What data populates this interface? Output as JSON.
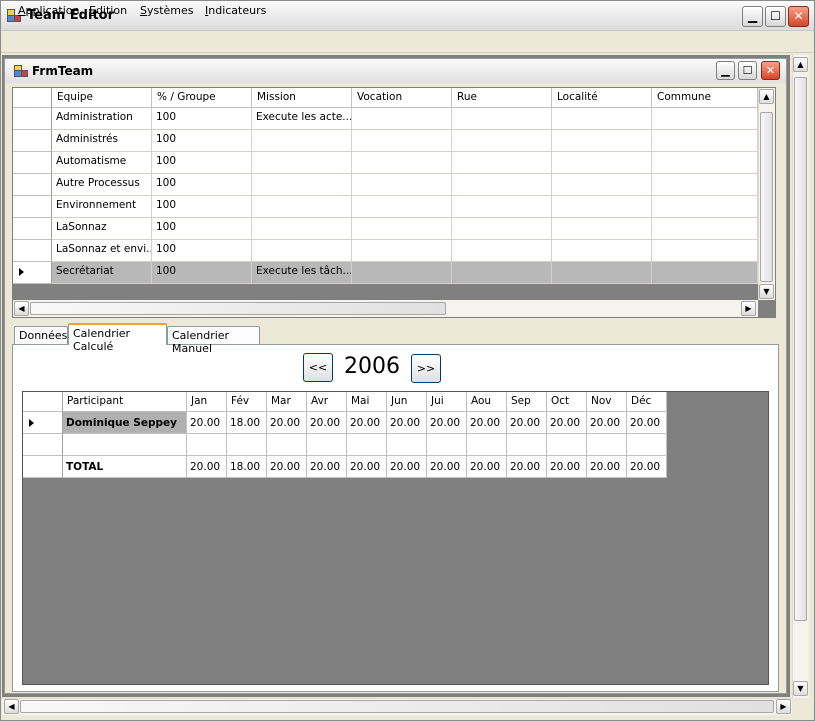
{
  "window": {
    "title": "Team Editor"
  },
  "menu": [
    "Application",
    "Edition",
    "Systèmes",
    "Indicateurs"
  ],
  "menu_underline": [
    "A",
    "E",
    "S",
    "I"
  ],
  "child": {
    "title": "FrmTeam"
  },
  "team_grid": {
    "columns": [
      "Equipe",
      "% / Groupe",
      "Mission",
      "Vocation",
      "Rue",
      "Localité",
      "Commune"
    ],
    "rows": [
      [
        "Administration",
        "100",
        "Execute les acte...",
        "",
        "",
        "",
        ""
      ],
      [
        "Administrés",
        "100",
        "",
        "",
        "",
        "",
        ""
      ],
      [
        "Automatisme",
        "100",
        "",
        "",
        "",
        "",
        ""
      ],
      [
        "Autre Processus",
        "100",
        "",
        "",
        "",
        "",
        ""
      ],
      [
        "Environnement",
        "100",
        "",
        "",
        "",
        "",
        ""
      ],
      [
        "LaSonnaz",
        "100",
        "",
        "",
        "",
        "",
        ""
      ],
      [
        "LaSonnaz et envi...",
        "100",
        "",
        "",
        "",
        "",
        ""
      ],
      [
        "Secrétariat",
        "100",
        "Execute les tâch...",
        "",
        "",
        "",
        ""
      ]
    ],
    "selected_row": 7
  },
  "tabs": [
    "Données",
    "Calendrier Calculé",
    "Calendrier Manuel"
  ],
  "active_tab": 1,
  "calendar": {
    "prev_label": "<<",
    "next_label": ">>",
    "year": "2006",
    "columns": [
      "Participant",
      "Jan",
      "Fév",
      "Mar",
      "Avr",
      "Mai",
      "Jun",
      "Jui",
      "Aou",
      "Sep",
      "Oct",
      "Nov",
      "Déc"
    ],
    "rows": [
      [
        "Dominique Seppey",
        "20.00",
        "18.00",
        "20.00",
        "20.00",
        "20.00",
        "20.00",
        "20.00",
        "20.00",
        "20.00",
        "20.00",
        "20.00",
        "20.00"
      ],
      [
        "",
        "",
        "",
        "",
        "",
        "",
        "",
        "",
        "",
        "",
        "",
        "",
        ""
      ],
      [
        "TOTAL",
        "20.00",
        "18.00",
        "20.00",
        "20.00",
        "20.00",
        "20.00",
        "20.00",
        "20.00",
        "20.00",
        "20.00",
        "20.00",
        "20.00"
      ]
    ]
  },
  "colors": {
    "selected_row": "#b8b8b8",
    "grid_bg": "#808080",
    "active_tab_accent": "#f0a030",
    "close_button": "#d6462a"
  }
}
